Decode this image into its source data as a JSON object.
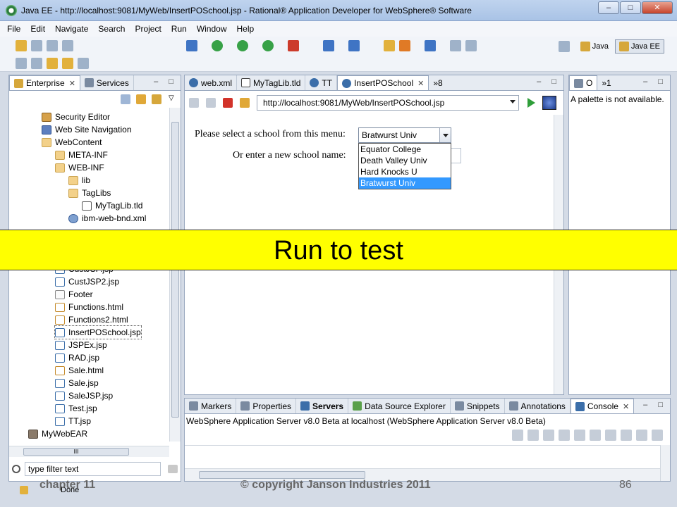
{
  "window": {
    "title": "Java EE - http://localhost:9081/MyWeb/InsertPOSchool.jsp - Rational® Application Developer for WebSphere® Software"
  },
  "menu": [
    "File",
    "Edit",
    "Navigate",
    "Search",
    "Project",
    "Run",
    "Window",
    "Help"
  ],
  "perspectives": {
    "java": "Java",
    "java_ee": "Java EE"
  },
  "left": {
    "tabs": [
      "Enterprise",
      "Services"
    ],
    "tree": [
      {
        "label": "Security Editor",
        "icon": "sec",
        "depth": 0
      },
      {
        "label": "Web Site Navigation",
        "icon": "nav",
        "depth": 0
      },
      {
        "label": "WebContent",
        "icon": "web",
        "depth": 0
      },
      {
        "label": "META-INF",
        "icon": "folder",
        "depth": 1
      },
      {
        "label": "WEB-INF",
        "icon": "folder",
        "depth": 1
      },
      {
        "label": "lib",
        "icon": "folder",
        "depth": 2
      },
      {
        "label": "TagLibs",
        "icon": "folder",
        "depth": 2
      },
      {
        "label": "MyTagLib.tld",
        "icon": "tld",
        "depth": 3
      },
      {
        "label": "ibm-web-bnd.xml",
        "icon": "xml",
        "depth": 2
      },
      {
        "label": "CustJSP.jsp",
        "icon": "jsp",
        "depth": 1,
        "gap": true
      },
      {
        "label": "CustJSP2.jsp",
        "icon": "jsp",
        "depth": 1
      },
      {
        "label": "Footer",
        "icon": "doc",
        "depth": 1
      },
      {
        "label": "Functions.html",
        "icon": "html",
        "depth": 1
      },
      {
        "label": "Functions2.html",
        "icon": "html",
        "depth": 1
      },
      {
        "label": "InsertPOSchool.jsp",
        "icon": "jsp",
        "depth": 1,
        "selected": true
      },
      {
        "label": "JSPEx.jsp",
        "icon": "jsp",
        "depth": 1
      },
      {
        "label": "RAD.jsp",
        "icon": "jsp",
        "depth": 1
      },
      {
        "label": "Sale.html",
        "icon": "html",
        "depth": 1
      },
      {
        "label": "Sale.jsp",
        "icon": "jsp",
        "depth": 1
      },
      {
        "label": "SaleJSP.jsp",
        "icon": "jsp",
        "depth": 1
      },
      {
        "label": "Test.jsp",
        "icon": "jsp",
        "depth": 1
      },
      {
        "label": "TT.jsp",
        "icon": "jsp",
        "depth": 1
      },
      {
        "label": "MyWebEAR",
        "icon": "ear",
        "depth": -1
      }
    ],
    "hscroll_label": "III",
    "filter_value": "type filter text"
  },
  "editor": {
    "tabs": [
      "web.xml",
      "MyTagLib.tld",
      "TT",
      "InsertPOSchool"
    ],
    "overflow": "»8",
    "url": "http://localhost:9081/MyWeb/InsertPOSchool.jsp",
    "prompt1": "Please select a school from this menu:",
    "prompt2": "Or enter a new school name:",
    "selected_school": "Bratwurst Univ",
    "options": [
      "Equator College",
      "Death Valley Univ",
      "Hard Knocks U",
      "Bratwurst Univ"
    ],
    "selected_index": 3
  },
  "palette": {
    "tabs": [
      "O",
      "»1"
    ],
    "message": "A palette is not available."
  },
  "bottom": {
    "tabs": [
      "Markers",
      "Properties",
      "Servers",
      "Data Source Explorer",
      "Snippets",
      "Annotations",
      "Console"
    ],
    "server_line": "WebSphere Application Server v8.0 Beta at localhost (WebSphere Application Server v8.0 Beta)"
  },
  "status": "Done",
  "banner": "Run to test",
  "footer": {
    "left": "chapter 11",
    "center": "© copyright Janson Industries 2011",
    "right": "86"
  }
}
